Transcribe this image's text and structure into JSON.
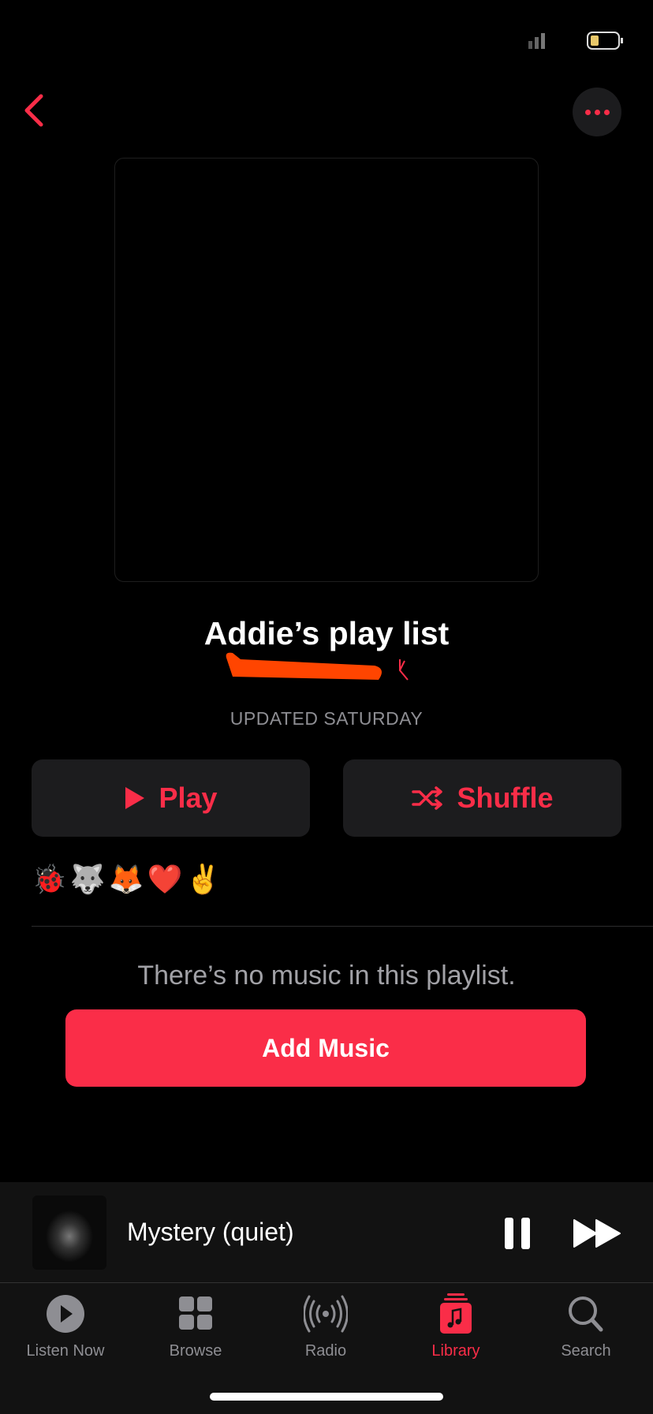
{
  "header": {
    "back_icon": "chevron-left-icon",
    "more_icon": "ellipsis-icon"
  },
  "playlist": {
    "title": "Addie’s play list",
    "updated": "UPDATED SATURDAY",
    "description": "🐞🐺🦊❤️✌️"
  },
  "actions": {
    "play_label": "Play",
    "shuffle_label": "Shuffle",
    "add_music_label": "Add Music"
  },
  "empty_message": "There’s no music in this playlist.",
  "now_playing": {
    "title": "Mystery (quiet)"
  },
  "tabs": [
    {
      "label": "Listen Now"
    },
    {
      "label": "Browse"
    },
    {
      "label": "Radio"
    },
    {
      "label": "Library",
      "active": true
    },
    {
      "label": "Search"
    }
  ],
  "colors": {
    "accent": "#fa2d48",
    "button_bg": "#1c1c1e",
    "redaction": "#ff4500"
  }
}
